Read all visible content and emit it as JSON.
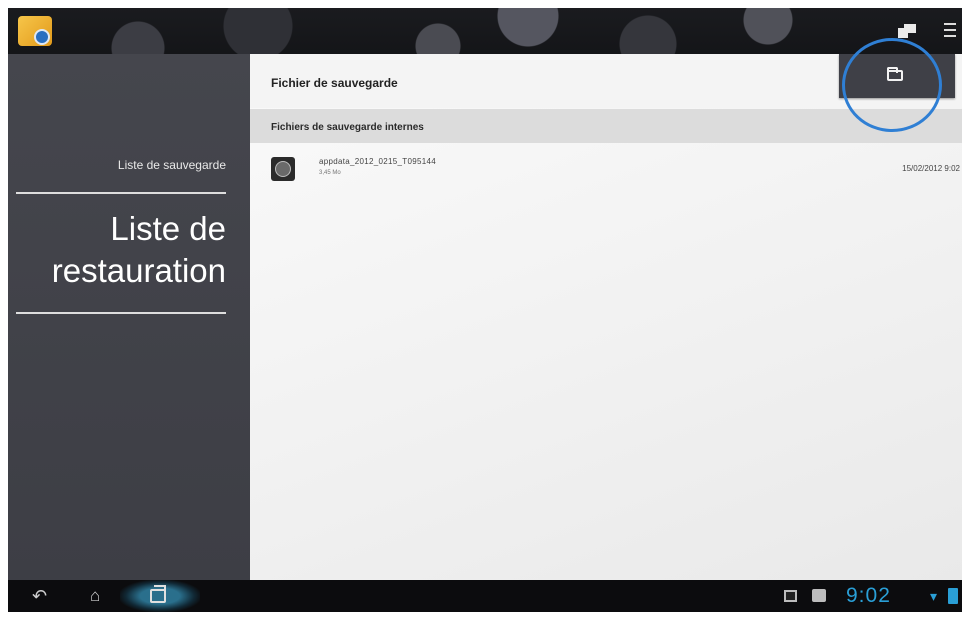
{
  "content": {
    "header_title": "Fichier de sauvegarde",
    "section_title": "Fichiers de sauvegarde internes",
    "files": [
      {
        "name": "appdata_2012_0215_T095144",
        "size": "3,45 Mo",
        "date": "15/02/2012 9:02"
      }
    ],
    "folder_button_icon": "folder-icon"
  },
  "sidebar": {
    "small_label": "Liste de sauvegarde",
    "big_label": "Liste de restauration"
  },
  "status_bar": {
    "clock": "9:02",
    "accent_color": "#2a9fd6"
  },
  "colors": {
    "sidebar_bg": "#45464d",
    "button_bg": "#3f4047",
    "highlight_circle": "#2f7fd4"
  }
}
